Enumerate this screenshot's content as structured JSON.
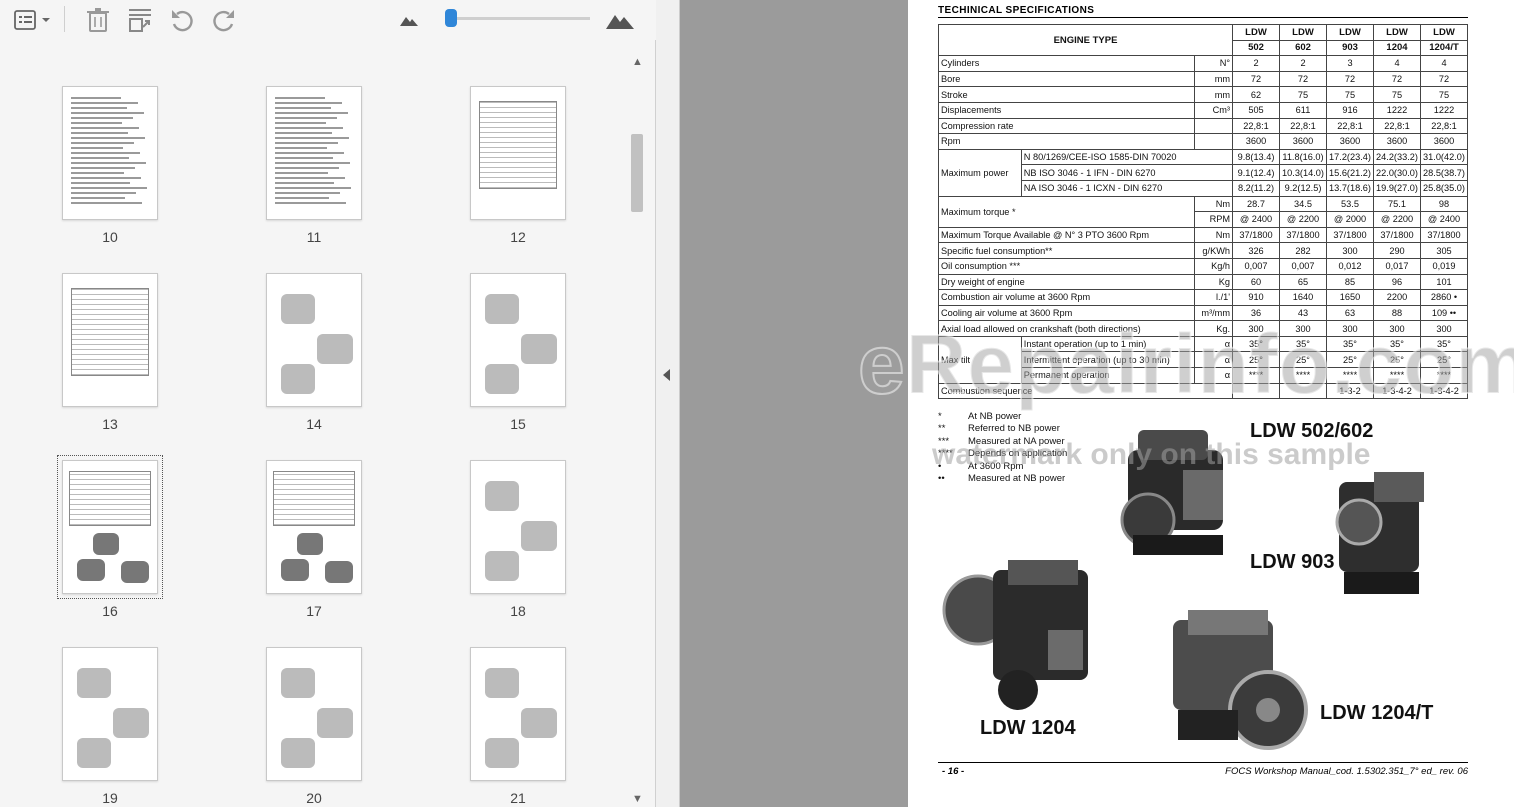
{
  "toolbar": {
    "icons": [
      "thumbnail-menu-icon",
      "delete-icon",
      "extract-icon",
      "undo-icon",
      "redo-icon",
      "zoom-out-icon",
      "zoom-in-icon"
    ],
    "zoom_level": 0.0
  },
  "thumbnails": [
    {
      "page": "10"
    },
    {
      "page": "11"
    },
    {
      "page": "12"
    },
    {
      "page": "13"
    },
    {
      "page": "14"
    },
    {
      "page": "15"
    },
    {
      "page": "16"
    },
    {
      "page": "17"
    },
    {
      "page": "18"
    },
    {
      "page": "19"
    },
    {
      "page": "20"
    },
    {
      "page": "21"
    }
  ],
  "selected_page": "16",
  "document": {
    "section_title": "TECHINICAL SPECIFICATIONS",
    "engine_type_label": "ENGINE TYPE",
    "models": [
      {
        "l1": "LDW",
        "l2": "502"
      },
      {
        "l1": "LDW",
        "l2": "602"
      },
      {
        "l1": "LDW",
        "l2": "903"
      },
      {
        "l1": "LDW",
        "l2": "1204"
      },
      {
        "l1": "LDW",
        "l2": "1204/T"
      }
    ],
    "rows": [
      {
        "label": "Cylinders",
        "unit": "N°",
        "values": [
          "2",
          "2",
          "3",
          "4",
          "4"
        ]
      },
      {
        "label": "Bore",
        "unit": "mm",
        "values": [
          "72",
          "72",
          "72",
          "72",
          "72"
        ]
      },
      {
        "label": "Stroke",
        "unit": "mm",
        "values": [
          "62",
          "75",
          "75",
          "75",
          "75"
        ]
      },
      {
        "label": "Displacements",
        "unit": "Cm³",
        "values": [
          "505",
          "611",
          "916",
          "1222",
          "1222"
        ]
      },
      {
        "label": "Compression rate",
        "unit": "",
        "values": [
          "22,8:1",
          "22,8:1",
          "22,8:1",
          "22,8:1",
          "22,8:1"
        ]
      },
      {
        "label": "Rpm",
        "unit": "",
        "values": [
          "3600",
          "3600",
          "3600",
          "3600",
          "3600"
        ]
      }
    ],
    "max_power": {
      "label": "Maximum power",
      "rows": [
        {
          "sub": "N   80/1269/CEE-ISO 1585-DIN 70020",
          "values": [
            "9.8(13.4)",
            "11.8(16.0)",
            "17.2(23.4)",
            "24.2(33.2)",
            "31.0(42.0)"
          ]
        },
        {
          "sub": "NB  ISO 3046 - 1 IFN - DIN 6270",
          "values": [
            "9.1(12.4)",
            "10.3(14.0)",
            "15.6(21.2)",
            "22.0(30.0)",
            "28.5(38.7)"
          ]
        },
        {
          "sub": "NA  ISO 3046 - 1 ICXN - DIN 6270",
          "values": [
            "8.2(11.2)",
            "9.2(12.5)",
            "13.7(18.6)",
            "19.9(27.0)",
            "25.8(35.0)"
          ]
        }
      ]
    },
    "max_torque": {
      "label": "Maximum torque *",
      "rows": [
        {
          "unit": "Nm",
          "values": [
            "28.7",
            "34.5",
            "53.5",
            "75.1",
            "98"
          ]
        },
        {
          "unit": "RPM",
          "values": [
            "@ 2400",
            "@ 2200",
            "@ 2000",
            "@ 2200",
            "@ 2400"
          ]
        }
      ]
    },
    "rows2": [
      {
        "label": "Maximum Torque Available @ N° 3 PTO 3600 Rpm",
        "unit": "Nm",
        "values": [
          "37/1800",
          "37/1800",
          "37/1800",
          "37/1800",
          "37/1800"
        ]
      },
      {
        "label": "Specific fuel consumption**",
        "unit": "g/KWh",
        "values": [
          "326",
          "282",
          "300",
          "290",
          "305"
        ]
      },
      {
        "label": "Oil consumption ***",
        "unit": "Kg/h",
        "values": [
          "0,007",
          "0,007",
          "0,012",
          "0,017",
          "0,019"
        ]
      },
      {
        "label": "Dry weight of engine",
        "unit": "Kg",
        "values": [
          "60",
          "65",
          "85",
          "96",
          "101"
        ]
      },
      {
        "label": "Combustion air volume at 3600 Rpm",
        "unit": "l./1'",
        "values": [
          "910",
          "1640",
          "1650",
          "2200",
          "2860 •"
        ]
      },
      {
        "label": "Cooling air volume at 3600 Rpm",
        "unit": "m³/mm",
        "values": [
          "36",
          "43",
          "63",
          "88",
          "109 ••"
        ]
      },
      {
        "label": "Axial load allowed on crankshaft (both directions)",
        "unit": "Kg.",
        "values": [
          "300",
          "300",
          "300",
          "300",
          "300"
        ]
      }
    ],
    "max_tilt": {
      "label": "Max tilt",
      "rows": [
        {
          "sub": "Instant operation (up to 1 min)",
          "unit": "α",
          "values": [
            "35°",
            "35°",
            "35°",
            "35°",
            "35°"
          ]
        },
        {
          "sub": "Intermittent operation (up to 30 min)",
          "unit": "α",
          "values": [
            "25°",
            "25°",
            "25°",
            "25°",
            "25°"
          ]
        },
        {
          "sub": "Permanent operation",
          "unit": "α",
          "values": [
            "****",
            "****",
            "****",
            "****",
            "****"
          ]
        }
      ]
    },
    "combustion": {
      "label": "Combustion sequence",
      "values": [
        "",
        "",
        "1-3-2",
        "1-3-4-2",
        "1-3-4-2"
      ]
    },
    "notes": [
      {
        "mark": "*",
        "text": "At NB power"
      },
      {
        "mark": "**",
        "text": "Referred to NB power"
      },
      {
        "mark": "***",
        "text": "Measured at NA power"
      },
      {
        "mark": "****",
        "text": "Depends on application"
      },
      {
        "mark": "•",
        "text": "At 3600 Rpm"
      },
      {
        "mark": "••",
        "text": "Measured at NB power"
      }
    ],
    "engine_labels": {
      "a": "LDW 502/602",
      "b": "LDW 903",
      "c": "LDW 1204",
      "d": "LDW 1204/T"
    },
    "footer_left": "- 16 -",
    "footer_right": "FOCS Workshop Manual_cod. 1.5302.351_7° ed_ rev. 06"
  },
  "watermark": {
    "main": "eRepairinfo.com",
    "sub": "watermark only on this sample"
  }
}
